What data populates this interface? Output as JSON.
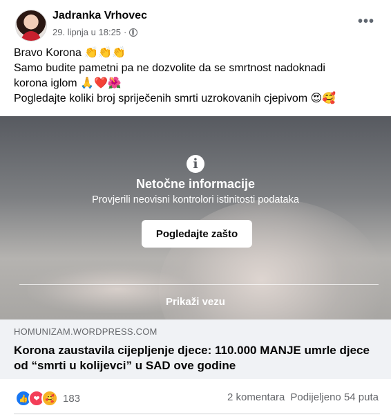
{
  "post": {
    "author": "Jadranka Vrhovec",
    "date": "29. lipnja u 18:25",
    "separator": "·",
    "more_label": "•••",
    "text_lines": [
      "Bravo Korona 👏👏👏",
      "Samo budite pametni pa ne dozvolite da se smrtnost nadoknadi",
      "korona iglom 🙏❤️🌺",
      "Pogledajte koliki broj spriječenih smrti uzrokovanih cjepivom 😍🥰"
    ]
  },
  "warning": {
    "icon_glyph": "i",
    "title": "Netočne informacije",
    "subtitle": "Provjerili neovisni kontrolori istinitosti podataka",
    "button": "Pogledajte zašto",
    "show_link": "Prikaži vezu"
  },
  "link_preview": {
    "domain": "HOMUNIZAM.WORDPRESS.COM",
    "headline": "Korona zaustavila cijepljenje djece: 110.000 MANJE umrle djece od “smrti u kolijevci” u SAD ove godine"
  },
  "footer": {
    "reactions": [
      {
        "name": "like",
        "glyph": "👍"
      },
      {
        "name": "love",
        "glyph": "❤"
      },
      {
        "name": "care",
        "glyph": "🥰"
      }
    ],
    "reaction_count": "183",
    "comments": "2 komentara",
    "shares": "Podijeljeno 54 puta"
  },
  "colors": {
    "accent": "#1877f2",
    "secondary_text": "#65676b",
    "link_bg": "#f0f2f5"
  }
}
